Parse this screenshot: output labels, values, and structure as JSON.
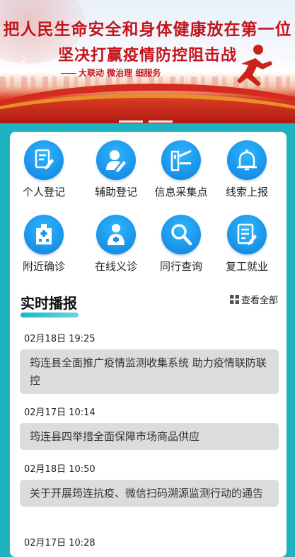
{
  "banner": {
    "headline_top": "把人民生命安全和身体健康放在第一位",
    "headline_main": "坚决打赢疫情防控阻击战",
    "slogan": "大联动  微治理  细服务",
    "prev_arrow": "‹",
    "next_arrow": "›"
  },
  "grid": {
    "items": [
      {
        "label": "个人登记",
        "icon": "form-edit-icon"
      },
      {
        "label": "辅助登记",
        "icon": "user-edit-icon"
      },
      {
        "label": "信息采集点",
        "icon": "gate-barrier-icon"
      },
      {
        "label": "线索上报",
        "icon": "bell-icon"
      },
      {
        "label": "附近确诊",
        "icon": "hospital-icon"
      },
      {
        "label": "在线义诊",
        "icon": "doctor-icon"
      },
      {
        "label": "同行查询",
        "icon": "search-icon"
      },
      {
        "label": "复工就业",
        "icon": "document-edit-icon"
      }
    ]
  },
  "live": {
    "title": "实时播报",
    "view_all": "查看全部",
    "news": [
      {
        "date": "02月18日 19:25",
        "text": "筠连县全面推广疫情监测收集系统 助力疫情联防联控"
      },
      {
        "date": "02月17日 10:14",
        "text": "筠连县四举措全面保障市场商品供应"
      },
      {
        "date": "02月18日 10:50",
        "text": "关于开展筠连抗疫、微信扫码溯源监测行动的通告"
      },
      {
        "date": "02月17日 10:28",
        "text": ""
      }
    ]
  },
  "colors": {
    "page_bg": "#1fb2c0",
    "icon_blue": "#1a93e8",
    "headline_red": "#c4151c",
    "news_box": "#dcdcdc"
  }
}
